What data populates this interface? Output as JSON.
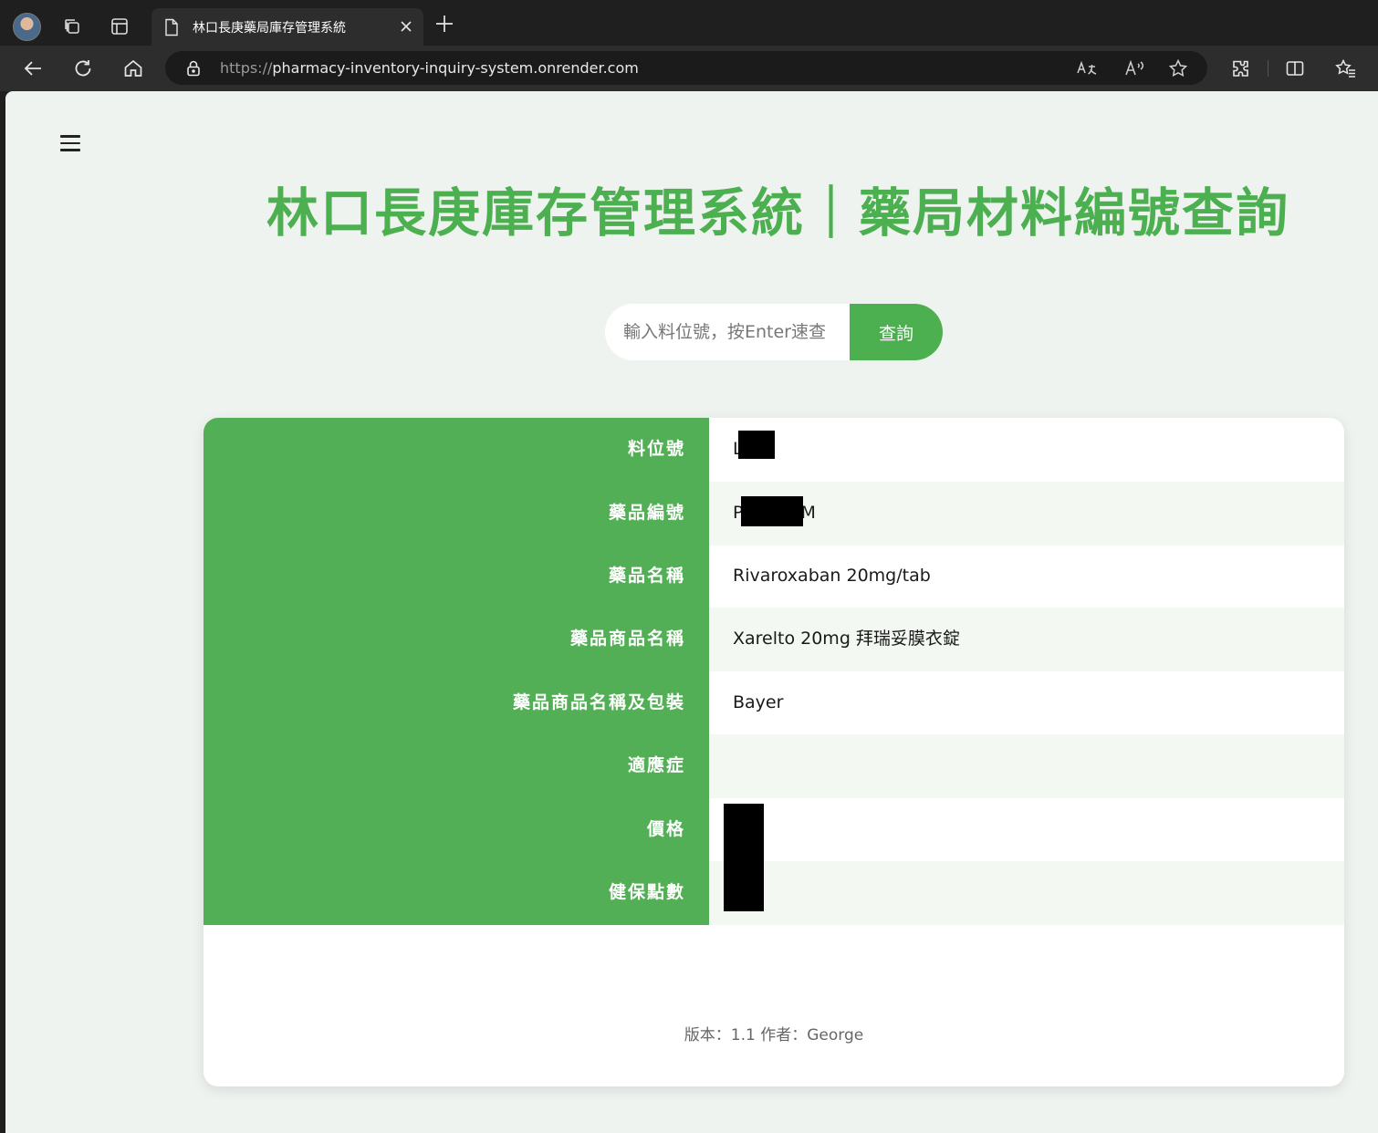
{
  "browser": {
    "tab_title": "林口長庚藥局庫存管理系統",
    "url_protocol": "https://",
    "url_host": "pharmacy-inventory-inquiry-system.onrender.com",
    "addr_icons": [
      "read-aloud-translate-icon",
      "read-aloud-icon",
      "favorite-star-icon"
    ],
    "accent_color": "#4caf50"
  },
  "page": {
    "title": "林口長庚庫存管理系統｜藥局材料編號查詢",
    "search": {
      "placeholder": "輸入料位號，按Enter速查",
      "value": "",
      "button_label": "查詢"
    },
    "rows": [
      {
        "label": "料位號",
        "value": "L"
      },
      {
        "label": "藥品編號",
        "value": "P",
        "value_suffix": "M"
      },
      {
        "label": "藥品名稱",
        "value": "Rivaroxaban 20mg/tab"
      },
      {
        "label": "藥品商品名稱",
        "value": "Xarelto 20mg 拜瑞妥膜衣錠"
      },
      {
        "label": "藥品商品名稱及包裝",
        "value": "Bayer"
      },
      {
        "label": "適應症",
        "value": ""
      },
      {
        "label": "價格",
        "value": ""
      },
      {
        "label": "健保點數",
        "value": ""
      }
    ],
    "footer": "版本：1.1 作者：George"
  }
}
